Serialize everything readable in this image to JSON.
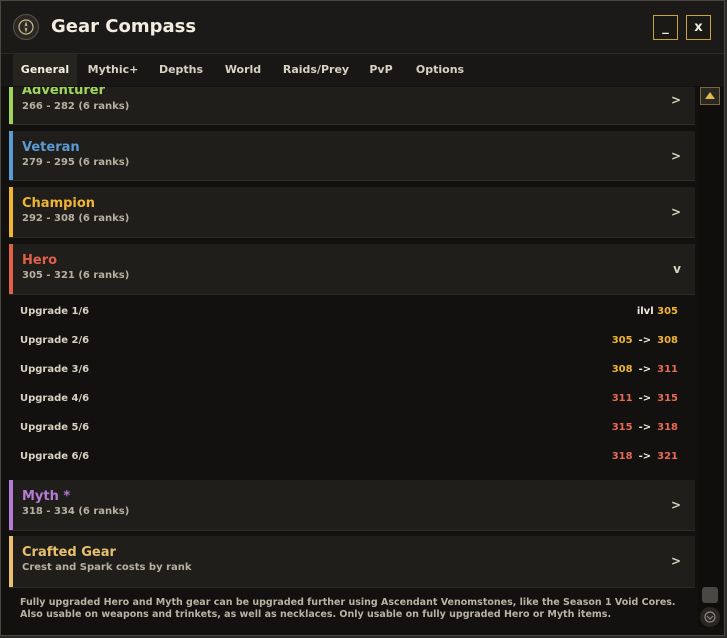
{
  "window": {
    "title": "Gear Compass",
    "minimize_label": "_",
    "close_label": "x"
  },
  "tabs": [
    {
      "label": "General",
      "active": true
    },
    {
      "label": "Mythic+"
    },
    {
      "label": "Depths"
    },
    {
      "label": "World"
    },
    {
      "label": "Raids/Prey"
    },
    {
      "label": "PvP"
    },
    {
      "label": "Options"
    }
  ],
  "tracks": [
    {
      "name": "Adventurer",
      "range": "266 - 282 (6 ranks)",
      "color": "#9fd65a",
      "chevron": ">"
    },
    {
      "name": "Veteran",
      "range": "279 - 295 (6 ranks)",
      "color": "#5b9bd5",
      "chevron": ">"
    },
    {
      "name": "Champion",
      "range": "292 - 308 (6 ranks)",
      "color": "#f0b533",
      "chevron": ">"
    },
    {
      "name": "Hero",
      "range": "305 - 321 (6 ranks)",
      "color": "#e0604a",
      "chevron": "v"
    },
    {
      "name": "Myth *",
      "range": "318 - 334 (6 ranks)",
      "color": "#b57bd6",
      "chevron": ">"
    },
    {
      "name": "Crafted Gear",
      "range": "Crest and Spark costs by rank",
      "color": "#e8c070",
      "chevron": ">"
    }
  ],
  "hero_upgrades": [
    {
      "label": "Upgrade 1/6",
      "prefix": "ilvl",
      "from": "305",
      "to": "",
      "from_color": "#f0b533",
      "to_color": ""
    },
    {
      "label": "Upgrade 2/6",
      "from": "305",
      "arrow": "->",
      "to": "308",
      "from_color": "#f0b533",
      "to_color": "#f0b533"
    },
    {
      "label": "Upgrade 3/6",
      "from": "308",
      "arrow": "->",
      "to": "311",
      "from_color": "#f0b533",
      "to_color": "#e86a55"
    },
    {
      "label": "Upgrade 4/6",
      "from": "311",
      "arrow": "->",
      "to": "315",
      "from_color": "#e86a55",
      "to_color": "#e86a55"
    },
    {
      "label": "Upgrade 5/6",
      "from": "315",
      "arrow": "->",
      "to": "318",
      "from_color": "#e86a55",
      "to_color": "#e86a55"
    },
    {
      "label": "Upgrade 6/6",
      "from": "318",
      "arrow": "->",
      "to": "321",
      "from_color": "#e86a55",
      "to_color": "#e86a55"
    }
  ],
  "footer": {
    "line1": "Fully upgraded Hero and Myth gear can be upgraded further using Ascendant Venomstones, like the Season 1 Void Cores.",
    "line2": "Also usable on weapons and trinkets, as well as necklaces. Only usable on fully upgraded Hero or Myth items."
  },
  "icons": {
    "logo": "compass-icon",
    "scroll_up": "scroll-up-arrow-icon",
    "scroll_down": "scroll-down-arrow-icon"
  },
  "colors": {
    "accent_gold": "#c9a43a",
    "window_bg": "#121110",
    "row_bg": "#1f1e1b"
  }
}
